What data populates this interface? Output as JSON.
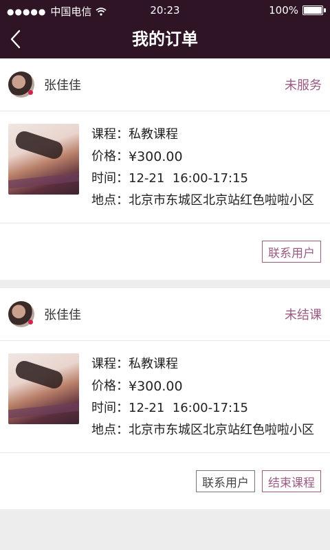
{
  "status_bar": {
    "carrier": "中国电信",
    "time": "20:23",
    "battery": "100%",
    "battery_level": 1.0
  },
  "nav": {
    "title": "我的订单"
  },
  "orders": [
    {
      "user_name": "张佳佳",
      "status": "未服务",
      "course_label": "课程：",
      "course": "私教课程",
      "price_label": "价格：",
      "price": "¥300.00",
      "time_label": "时间：",
      "time": "12-21  16:00-17:15",
      "location_label": "地点：",
      "location": "北京市东城区北京站红色啦啦小区",
      "buttons": [
        "联系用户"
      ]
    },
    {
      "user_name": "张佳佳",
      "status": "未结课",
      "course_label": "课程：",
      "course": "私教课程",
      "price_label": "价格：",
      "price": "¥300.00",
      "time_label": "时间：",
      "time": "12-21  16:00-17:15",
      "location_label": "地点：",
      "location": "北京市东城区北京站红色啦啦小区",
      "buttons": [
        "联系用户",
        "结束课程"
      ]
    }
  ],
  "colors": {
    "header_bg": "#2f1425",
    "accent": "#9b5a83"
  }
}
